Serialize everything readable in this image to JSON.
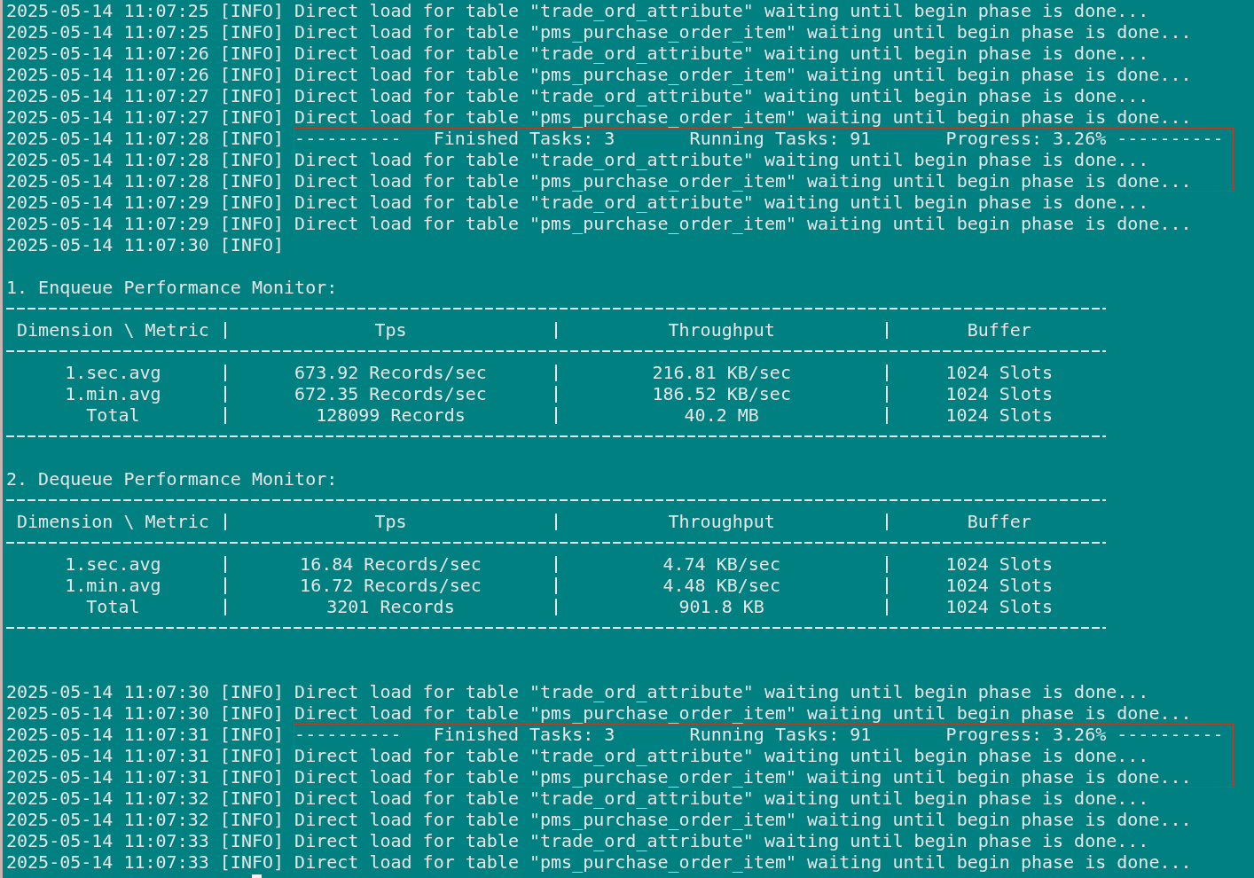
{
  "terminal": {
    "sections": [
      {
        "kind": "log",
        "lines": [
          {
            "timestamp": "2025-05-14 11:07:25",
            "level": "[INFO]",
            "message": "Direct load for table \"trade_ord_attribute\" waiting until begin phase is done...",
            "boxed": false
          },
          {
            "timestamp": "2025-05-14 11:07:25",
            "level": "[INFO]",
            "message": "Direct load for table \"pms_purchase_order_item\" waiting until begin phase is done...",
            "boxed": false
          },
          {
            "timestamp": "2025-05-14 11:07:26",
            "level": "[INFO]",
            "message": "Direct load for table \"trade_ord_attribute\" waiting until begin phase is done...",
            "boxed": false
          },
          {
            "timestamp": "2025-05-14 11:07:26",
            "level": "[INFO]",
            "message": "Direct load for table \"pms_purchase_order_item\" waiting until begin phase is done...",
            "boxed": false
          },
          {
            "timestamp": "2025-05-14 11:07:27",
            "level": "[INFO]",
            "message": "Direct load for table \"trade_ord_attribute\" waiting until begin phase is done...",
            "boxed": false
          },
          {
            "timestamp": "2025-05-14 11:07:27",
            "level": "[INFO]",
            "message": "Direct load for table \"pms_purchase_order_item\" waiting until begin phase is done...",
            "boxed": false
          },
          {
            "timestamp": "2025-05-14 11:07:28",
            "level": "[INFO]",
            "message": "----------   Finished Tasks: 3       Running Tasks: 91       Progress: 3.26% ----------",
            "boxed": true
          },
          {
            "timestamp": "2025-05-14 11:07:28",
            "level": "[INFO]",
            "message": "Direct load for table \"trade_ord_attribute\" waiting until begin phase is done...",
            "boxed": true
          },
          {
            "timestamp": "2025-05-14 11:07:28",
            "level": "[INFO]",
            "message": "Direct load for table \"pms_purchase_order_item\" waiting until begin phase is done...",
            "boxed": true
          },
          {
            "timestamp": "2025-05-14 11:07:29",
            "level": "[INFO]",
            "message": "Direct load for table \"trade_ord_attribute\" waiting until begin phase is done...",
            "boxed": false
          },
          {
            "timestamp": "2025-05-14 11:07:29",
            "level": "[INFO]",
            "message": "Direct load for table \"pms_purchase_order_item\" waiting until begin phase is done...",
            "boxed": false
          },
          {
            "timestamp": "2025-05-14 11:07:30",
            "level": "[INFO]",
            "boxed": false
          }
        ]
      },
      {
        "kind": "blank"
      },
      {
        "kind": "table",
        "title": "1. Enqueue Performance Monitor:",
        "columns": [
          "Dimension \\ Metric",
          "Tps",
          "Throughput",
          "Buffer"
        ],
        "rows": [
          [
            "1.sec.avg",
            "673.92 Records/sec",
            "216.81 KB/sec",
            "1024 Slots"
          ],
          [
            "1.min.avg",
            "672.35 Records/sec",
            "186.52 KB/sec",
            "1024 Slots"
          ],
          [
            "Total",
            "128099 Records",
            "40.2 MB",
            "1024 Slots"
          ]
        ]
      },
      {
        "kind": "blank"
      },
      {
        "kind": "table",
        "title": "2. Dequeue Performance Monitor:",
        "columns": [
          "Dimension \\ Metric",
          "Tps",
          "Throughput",
          "Buffer"
        ],
        "rows": [
          [
            "1.sec.avg",
            "16.84 Records/sec",
            "4.74 KB/sec",
            "1024 Slots"
          ],
          [
            "1.min.avg",
            "16.72 Records/sec",
            "4.48 KB/sec",
            "1024 Slots"
          ],
          [
            "Total",
            "3201 Records",
            "901.8 KB",
            "1024 Slots"
          ]
        ]
      },
      {
        "kind": "blank"
      },
      {
        "kind": "blank"
      },
      {
        "kind": "log",
        "lines": [
          {
            "timestamp": "2025-05-14 11:07:30",
            "level": "[INFO]",
            "message": "Direct load for table \"trade_ord_attribute\" waiting until begin phase is done...",
            "boxed": false
          },
          {
            "timestamp": "2025-05-14 11:07:30",
            "level": "[INFO]",
            "message": "Direct load for table \"pms_purchase_order_item\" waiting until begin phase is done...",
            "boxed": false
          },
          {
            "timestamp": "2025-05-14 11:07:31",
            "level": "[INFO]",
            "message": "----------   Finished Tasks: 3       Running Tasks: 91       Progress: 3.26% ----------",
            "boxed": true
          },
          {
            "timestamp": "2025-05-14 11:07:31",
            "level": "[INFO]",
            "message": "Direct load for table \"trade_ord_attribute\" waiting until begin phase is done...",
            "boxed": true
          },
          {
            "timestamp": "2025-05-14 11:07:31",
            "level": "[INFO]",
            "message": "Direct load for table \"pms_purchase_order_item\" waiting until begin phase is done...",
            "boxed": true
          },
          {
            "timestamp": "2025-05-14 11:07:32",
            "level": "[INFO]",
            "message": "Direct load for table \"trade_ord_attribute\" waiting until begin phase is done...",
            "boxed": false
          },
          {
            "timestamp": "2025-05-14 11:07:32",
            "level": "[INFO]",
            "message": "Direct load for table \"pms_purchase_order_item\" waiting until begin phase is done...",
            "boxed": false
          },
          {
            "timestamp": "2025-05-14 11:07:33",
            "level": "[INFO]",
            "message": "Direct load for table \"trade_ord_attribute\" waiting until begin phase is done...",
            "boxed": false
          },
          {
            "timestamp": "2025-05-14 11:07:33",
            "level": "[INFO]",
            "message": "Direct load for table \"pms_purchase_order_item\" waiting until begin phase is done...",
            "boxed": false
          }
        ]
      },
      {
        "kind": "prompt"
      }
    ]
  }
}
